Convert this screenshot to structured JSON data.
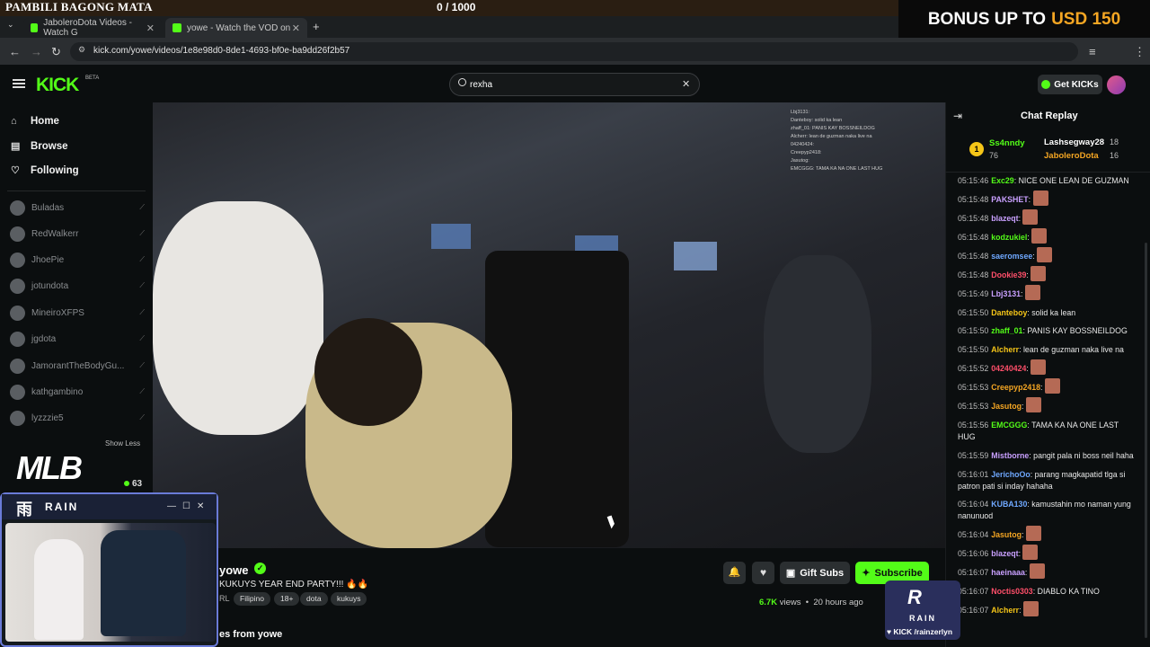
{
  "overlay": {
    "title": "PAMBILI BAGONG MATA",
    "score": "0   / 1000",
    "bonus_label": "BONUS UP TO",
    "bonus_value": "USD 150"
  },
  "browser": {
    "tabs": [
      {
        "label": "JaboleroDota Videos - Watch G",
        "close": "✕"
      },
      {
        "label": "yowe - Watch the VOD on",
        "close": "✕"
      }
    ],
    "new_tab": "+",
    "url": "kick.com/yowe/videos/1e8e98d0-8de1-4693-bf0e-ba9dd26f2b57"
  },
  "header": {
    "logo": "KICK",
    "beta": "BETA",
    "search_value": "rexha",
    "get_kicks": "Get KICKs"
  },
  "sidebar": {
    "nav": [
      {
        "label": "Home",
        "icon": "home-icon"
      },
      {
        "label": "Browse",
        "icon": "browse-icon"
      },
      {
        "label": "Following",
        "icon": "heart-icon"
      }
    ],
    "following": [
      "Buladas",
      "RedWalkerr",
      "JhoePie",
      "jotundota",
      "MineiroXFPS",
      "jgdota",
      "JamorantTheBodyGu...",
      "kathgambino",
      "lyzzzie5"
    ],
    "show_less": "Show Less",
    "promo_logo": "MLB",
    "promo_viewers": "63"
  },
  "video": {
    "cursor": "pointer"
  },
  "vod": {
    "channel": "yowe",
    "title": "KUKUYS YEAR END PARTY!!! 🔥🔥",
    "lang_prefix": "RL",
    "tags": [
      "Filipino",
      "18+",
      "dota",
      "kukuys"
    ],
    "gift_subs": "Gift Subs",
    "subscribe": "Subscribe",
    "views": "6.7K",
    "views_label": "views",
    "age": "20 hours ago",
    "more_from": "es from yowe"
  },
  "chat": {
    "title": "Chat Replay",
    "leaders": [
      {
        "rank": "1",
        "name": "Ss4nndy",
        "value": "76",
        "color": "#53fc18"
      },
      {
        "name": "Lashsegway28",
        "value": "18",
        "color": "#ffffff"
      },
      {
        "name": "JaboleroDota",
        "value": "16",
        "color": "#f5a623"
      }
    ],
    "messages": [
      {
        "ts": "05:15:46",
        "user": "Exc29",
        "color": "#53fc18",
        "text": "NICE ONE LEAN DE GUZMAN",
        "emote": false
      },
      {
        "ts": "05:15:48",
        "user": "PAKSHET",
        "color": "#c9a0ff",
        "text": "",
        "emote": true
      },
      {
        "ts": "05:15:48",
        "user": "blazeqt",
        "color": "#c9a0ff",
        "text": "",
        "emote": true
      },
      {
        "ts": "05:15:48",
        "user": "kodzukiel",
        "color": "#53fc18",
        "text": "",
        "emote": true
      },
      {
        "ts": "05:15:48",
        "user": "saeromsee",
        "color": "#6fa8ff",
        "text": "",
        "emote": true
      },
      {
        "ts": "05:15:48",
        "user": "Dookie39",
        "color": "#ff4f6a",
        "text": "",
        "emote": true
      },
      {
        "ts": "05:15:49",
        "user": "Lbj3131",
        "color": "#c9a0ff",
        "text": "",
        "emote": true
      },
      {
        "ts": "05:15:50",
        "user": "Danteboy",
        "color": "#f5c518",
        "text": "solid ka lean",
        "emote": false
      },
      {
        "ts": "05:15:50",
        "user": "zhaff_01",
        "color": "#53fc18",
        "text": "PANIS KAY BOSSNEILDOG",
        "emote": false
      },
      {
        "ts": "05:15:50",
        "user": "Alcherr",
        "color": "#f5c518",
        "text": "lean de guzman naka live na",
        "emote": false
      },
      {
        "ts": "05:15:52",
        "user": "04240424",
        "color": "#ff4f6a",
        "text": "",
        "emote": true
      },
      {
        "ts": "05:15:53",
        "user": "Creepyp2418",
        "color": "#f5a623",
        "text": "",
        "emote": true
      },
      {
        "ts": "05:15:53",
        "user": "Jasutog",
        "color": "#f5a623",
        "text": "",
        "emote": true
      },
      {
        "ts": "05:15:56",
        "user": "EMCGGG",
        "color": "#53fc18",
        "text": "TAMA KA NA ONE LAST HUG",
        "emote": false
      },
      {
        "ts": "05:15:59",
        "user": "Mistborne",
        "color": "#c9a0ff",
        "text": "pangit pala ni boss neil haha",
        "emote": false
      },
      {
        "ts": "05:16:01",
        "user": "JerichoOo",
        "color": "#6fa8ff",
        "text": "parang magkapatid tlga si patron pati si inday hahaha",
        "emote": false
      },
      {
        "ts": "05:16:04",
        "user": "KUBA130",
        "color": "#6fa8ff",
        "text": "kamustahin mo naman yung nanunuod",
        "emote": false
      },
      {
        "ts": "05:16:04",
        "user": "Jasutog",
        "color": "#f5a623",
        "text": "",
        "emote": true
      },
      {
        "ts": "05:16:06",
        "user": "blazeqt",
        "color": "#c9a0ff",
        "text": "",
        "emote": true
      },
      {
        "ts": "05:16:07",
        "user": "haeinaaa",
        "color": "#c9a0ff",
        "text": "",
        "emote": true
      },
      {
        "ts": "05:16:07",
        "user": "Noctis0303",
        "color": "#ff4f6a",
        "text": "DIABLO KA TINO",
        "emote": false
      },
      {
        "ts": "05:16:07",
        "user": "Alcherr",
        "color": "#f5c518",
        "text": "",
        "emote": true
      }
    ]
  },
  "webcam": {
    "icon_char": "雨",
    "brand": "RAIN"
  },
  "rain_badge": {
    "logo": "R",
    "word": "RAIN",
    "social": "♥ KICK /rainzerlyn"
  },
  "colors": {
    "kick_green": "#53fc18",
    "bonus_orange": "#f5a623",
    "background": "#0b0e0f"
  }
}
